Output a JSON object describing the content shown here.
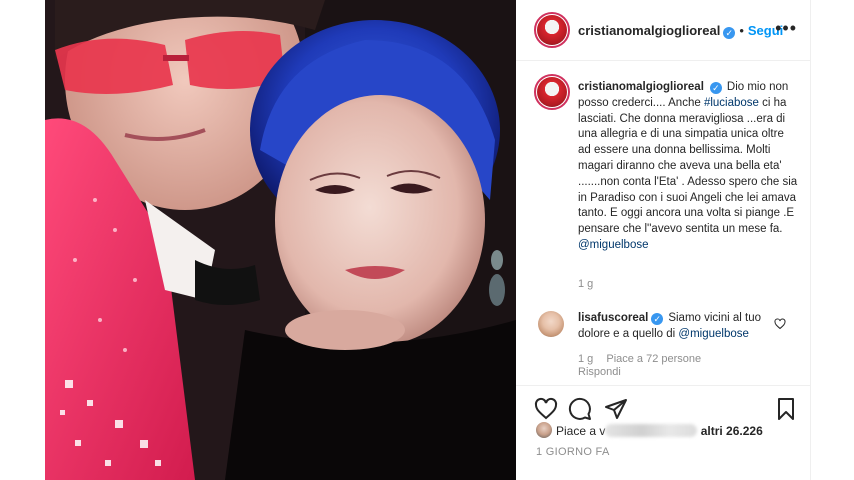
{
  "post": {
    "author": "cristianomalgioglioreal",
    "follow_label": "Segui",
    "dot": "•",
    "more_label": "•••",
    "caption": {
      "part1": "Dio mio non posso crederci.... Anche ",
      "hashtag": "#luciabose",
      "part2": " ci ha lasciati. Che donna meravigliosa ...era di una allegria e di una simpatia unica oltre ad essere una donna bellissima. Molti magari diranno che aveva una bella eta' .......non conta l'Eta' . Adesso spero che sia in Paradiso con i suoi Angeli che lei amava tanto. E oggi ancora una volta si piange .E pensare che l''avevo sentita un mese fa. ",
      "mention": "@miguelbose"
    },
    "caption_time": "1 g"
  },
  "comment": {
    "author": "lisafuscoreal",
    "text": "Siamo vicini al tuo dolore e a quello di ",
    "mention": "@miguelbose",
    "time": "1 g",
    "likes": "Piace a 72 persone",
    "reply": "Rispondi"
  },
  "actions": {
    "like_icon": "heart-icon",
    "comment_icon": "comment-icon",
    "share_icon": "share-icon",
    "save_icon": "bookmark-icon"
  },
  "likes": {
    "prefix": "Piace a v",
    "suffix": " altri 26.226"
  },
  "date_label": "1 GIORNO FA",
  "colors": {
    "verified": "#3897f0",
    "follow": "#0095f6",
    "link": "#00376b",
    "muted": "#8e8e8e",
    "story_ring": "#d0315e"
  }
}
